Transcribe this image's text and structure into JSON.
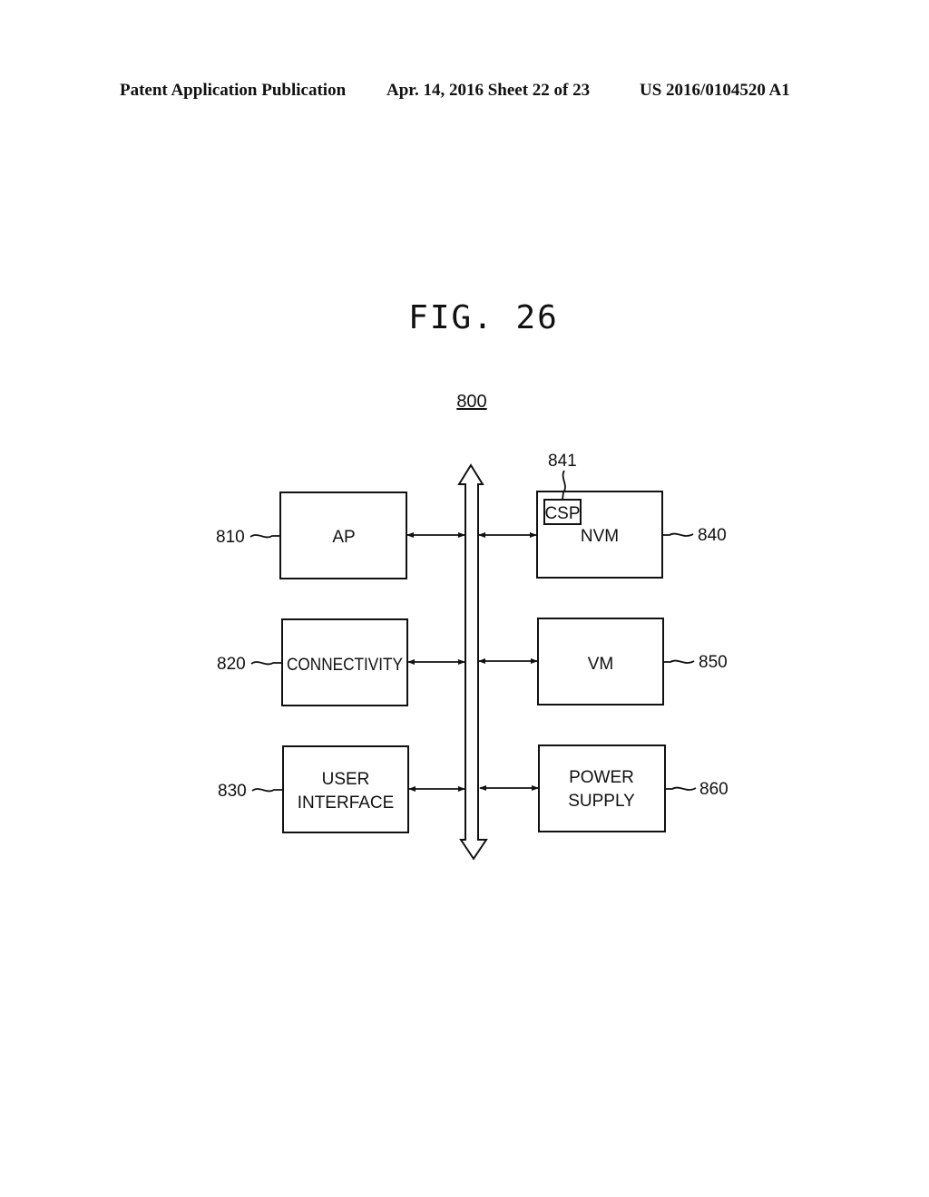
{
  "header": {
    "publication": "Patent Application Publication",
    "date_sheet": "Apr. 14, 2016  Sheet 22 of 23",
    "number": "US 2016/0104520 A1"
  },
  "figure": {
    "title": "FIG. 26",
    "system_label": "800",
    "bus": "bidirectional system bus",
    "blocks": [
      {
        "ref": "810",
        "label_lines": [
          "AP"
        ]
      },
      {
        "ref": "820",
        "label_lines": [
          "CONNECTIVITY"
        ]
      },
      {
        "ref": "830",
        "label_lines": [
          "USER",
          "INTERFACE"
        ]
      },
      {
        "ref": "840",
        "label_lines": [
          "NVM"
        ],
        "sub_block": {
          "ref": "841",
          "label": "CSP"
        }
      },
      {
        "ref": "850",
        "label_lines": [
          "VM"
        ]
      },
      {
        "ref": "860",
        "label_lines": [
          "POWER",
          "SUPPLY"
        ]
      }
    ]
  }
}
